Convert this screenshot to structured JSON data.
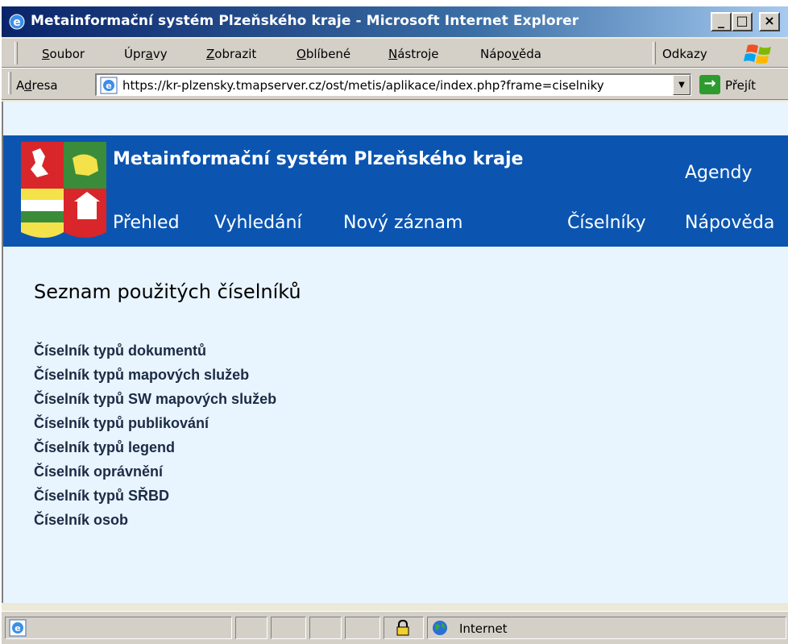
{
  "window": {
    "title": "Metainformační systém Plzeňského kraje - Microsoft Internet Explorer",
    "min": "_",
    "max": "□",
    "close": "×"
  },
  "menu": {
    "items": [
      {
        "prefix": "",
        "ul": "S",
        "rest": "oubor"
      },
      {
        "prefix": "Úpr",
        "ul": "a",
        "rest": "vy"
      },
      {
        "prefix": "",
        "ul": "Z",
        "rest": "obrazit"
      },
      {
        "prefix": "",
        "ul": "O",
        "rest": "blíbené"
      },
      {
        "prefix": "",
        "ul": "N",
        "rest": "ástroje"
      },
      {
        "prefix": "Nápo",
        "ul": "v",
        "rest": "ěda"
      }
    ],
    "links_label": "Odkazy"
  },
  "address": {
    "label_prefix": "A",
    "label_ul": "d",
    "label_rest": "resa",
    "url": "https://kr-plzensky.tmapserver.cz/ost/metis/aplikace/index.php?frame=ciselniky",
    "go_label": "Přejít"
  },
  "site": {
    "title": "Metainformační systém Plzeňského kraje",
    "agendy": "Agendy",
    "nav": [
      "Přehled",
      "Vyhledání",
      "Nový záznam",
      "Číselníky",
      "Nápověda"
    ]
  },
  "page": {
    "title": "Seznam použitých číselníků",
    "links": [
      "Číselník typů dokumentů",
      "Číselník typů mapových služeb",
      "Číselník typů SW mapových služeb",
      "Číselník typů publikování",
      "Číselník typů legend",
      "Číselník oprávnění",
      "Číselník typů SŘBD",
      "Číselník osob"
    ]
  },
  "status": {
    "zone": "Internet"
  },
  "colors": {
    "header_blue": "#0b55b1",
    "content_bg": "#e8f4fe",
    "link_color": "#1c2b45"
  }
}
